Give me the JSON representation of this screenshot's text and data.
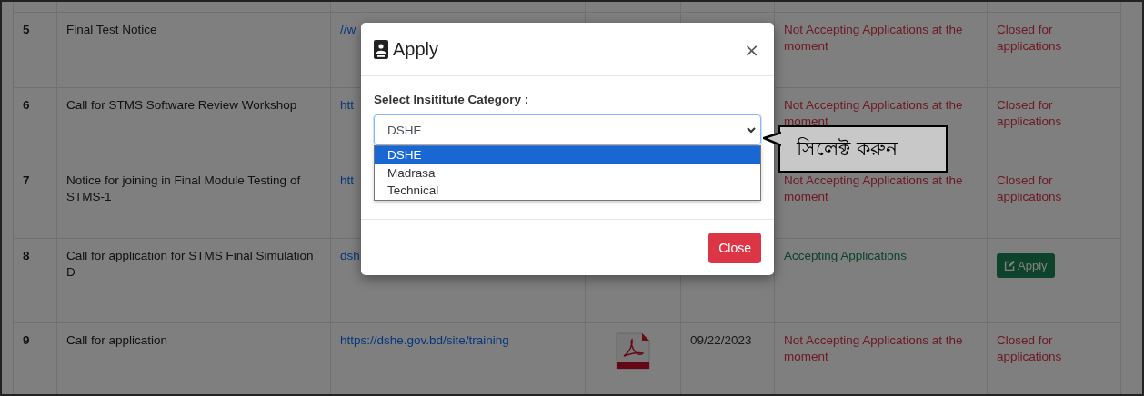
{
  "table": {
    "rows": [
      {
        "number": "5",
        "title": "Final Test Notice",
        "link": "//w",
        "status": {
          "text": "Not Accepting Applications at the moment",
          "kind": "closed"
        },
        "action": {
          "kind": "text",
          "label": "Closed for applications"
        }
      },
      {
        "number": "6",
        "title": "Call for STMS Software Review Workshop",
        "link": "htt",
        "status": {
          "text": "Not Accepting Applications at the moment",
          "kind": "closed"
        },
        "action": {
          "kind": "text",
          "label": "Closed for applications"
        }
      },
      {
        "number": "7",
        "title": "Notice for joining in Final Module Testing of STMS-1",
        "link": "htt",
        "status": {
          "text": "Not Accepting Applications at the moment",
          "kind": "closed"
        },
        "action": {
          "kind": "text",
          "label": "Closed for applications"
        }
      },
      {
        "number": "8",
        "title": "Call for application for STMS Final Simulation D",
        "link": "dsh",
        "status": {
          "text": "Accepting Applications",
          "kind": "open"
        },
        "action": {
          "kind": "button",
          "label": "Apply"
        }
      },
      {
        "number": "9",
        "title": "Call for application",
        "link": "https://dshe.gov.bd/site/training",
        "has_file": true,
        "date": "09/22/2023",
        "status": {
          "text": "Not Accepting Applications at the moment",
          "kind": "closed"
        },
        "action": {
          "kind": "text",
          "label": "Closed for applications"
        }
      }
    ]
  },
  "modal": {
    "title": "Apply",
    "close_symbol": "×",
    "field_label": "Select Insititute Category :",
    "select": {
      "value": "DSHE",
      "expanded": true,
      "options": [
        {
          "label": "DSHE",
          "selected": true
        },
        {
          "label": "Madrasa",
          "selected": false
        },
        {
          "label": "Technical",
          "selected": false
        }
      ]
    },
    "buttons": [
      "Close"
    ]
  },
  "callout": {
    "text": "সিলেক্ট করুন"
  }
}
